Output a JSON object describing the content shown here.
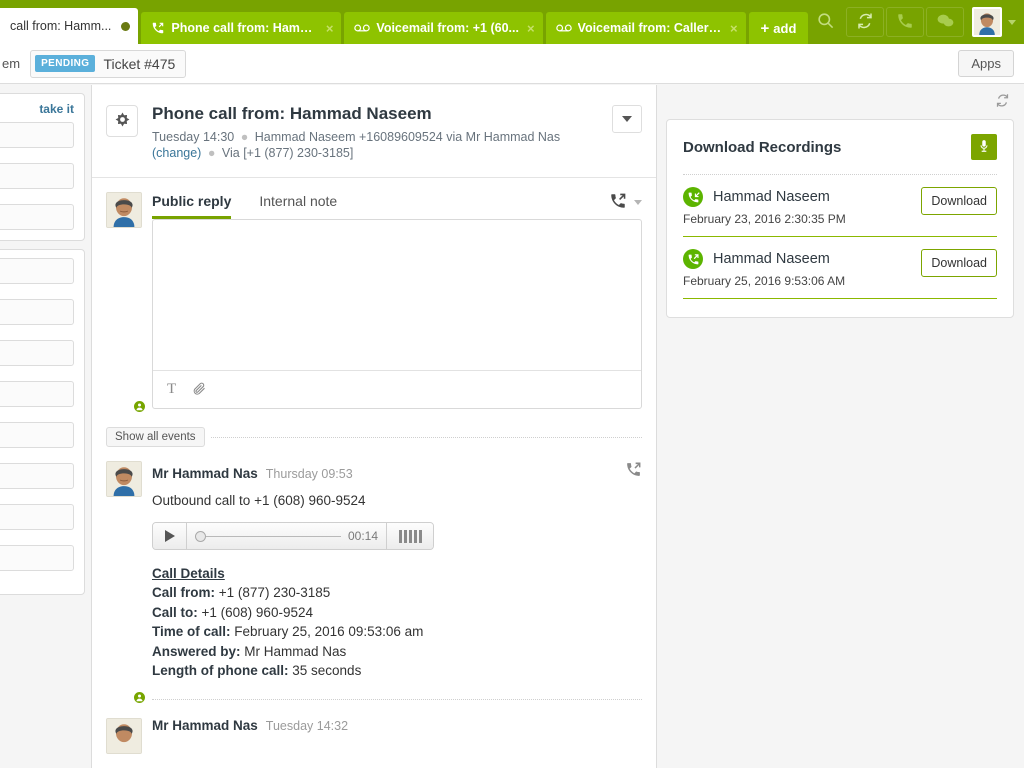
{
  "topbar": {
    "tabs": [
      {
        "label": "call from: Hamm...",
        "icon": "phone-icon",
        "active": true,
        "truncated_left": true
      },
      {
        "label": "Phone call from: Hamm...",
        "icon": "outbound-call-icon",
        "active": false
      },
      {
        "label": "Voicemail from: +1 (60...",
        "icon": "voicemail-icon",
        "active": false
      },
      {
        "label": "Voicemail from: Caller ...",
        "icon": "voicemail-icon",
        "active": false
      }
    ],
    "add_label": "add",
    "close_glyph": "×",
    "icons": [
      "search-icon",
      "refresh-icon",
      "phone-icon",
      "chat-icon",
      "user-avatar"
    ],
    "brand_color": "#78a300",
    "tab_color": "#8ec300"
  },
  "subbar": {
    "left_cut_text": "em",
    "status_badge": "PENDING",
    "ticket_number": "Ticket #475",
    "apps_label": "Apps",
    "badge_color": "#5bb0db"
  },
  "sidebar": {
    "take_it_label": "take it"
  },
  "ticket": {
    "title": "Phone call from: Hammad Naseem",
    "meta_time": "Tuesday 14:30",
    "meta_requester": "Hammad Naseem +16089609524 via Mr Hammad Nas",
    "change_label": "(change)",
    "meta_via": "Via [+1 (877) 230-3185]",
    "gear_icon": "gear-icon"
  },
  "composer": {
    "tabs": [
      {
        "label": "Public reply",
        "active": true
      },
      {
        "label": "Internal note",
        "active": false
      }
    ],
    "channel_icon": "outbound-call-icon",
    "toolbar": {
      "text_format_label": "T",
      "attach_icon": "paperclip-icon"
    }
  },
  "events": {
    "show_all_label": "Show all events",
    "items": [
      {
        "author": "Mr Hammad Nas",
        "time": "Thursday 09:53",
        "text": "Outbound call to +1 (608) 960-9524",
        "channel_icon": "outbound-call-icon",
        "player": {
          "time": "00:14",
          "play_icon": "play-icon",
          "waveform_icon": "waveform-icon"
        },
        "details_title": "Call Details",
        "details": [
          {
            "label": "Call from:",
            "value": "+1 (877) 230-3185"
          },
          {
            "label": "Call to:",
            "value": "+1 (608) 960-9524"
          },
          {
            "label": "Time of call:",
            "value": "February 25, 2016 09:53:06 am"
          },
          {
            "label": "Answered by:",
            "value": "Mr Hammad Nas"
          },
          {
            "label": "Length of phone call:",
            "value": "35 seconds"
          }
        ]
      },
      {
        "author": "Mr Hammad Nas",
        "time": "Tuesday 14:32"
      }
    ]
  },
  "rightpanel": {
    "refresh_icon": "refresh-icon",
    "card": {
      "title": "Download Recordings",
      "mic_icon": "microphone-icon",
      "recordings": [
        {
          "name": "Hammad Naseem",
          "date": "February 23, 2016 2:30:35 PM",
          "direction_icon": "inbound-call-icon",
          "download_label": "Download"
        },
        {
          "name": "Hammad Naseem",
          "date": "February 25, 2016 9:53:06 AM",
          "direction_icon": "outbound-call-icon",
          "download_label": "Download"
        }
      ]
    },
    "accent_color": "#7ca500"
  }
}
